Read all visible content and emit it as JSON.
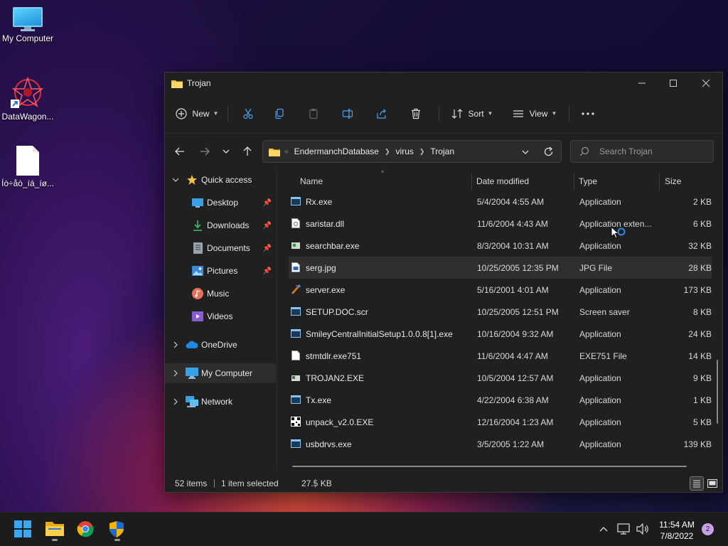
{
  "desktop": {
    "icons": [
      {
        "label": "My Computer"
      },
      {
        "label": "DataWagon..."
      },
      {
        "label": "Íò÷åò_íá_íø..."
      }
    ]
  },
  "window": {
    "title": "Trojan",
    "toolbar": {
      "new_label": "New",
      "sort_label": "Sort",
      "view_label": "View"
    },
    "address": {
      "crumbs": [
        "EndermanchDatabase",
        "virus",
        "Trojan"
      ]
    },
    "search": {
      "placeholder": "Search Trojan"
    },
    "nav": {
      "quick_access": "Quick access",
      "items": [
        {
          "label": "Desktop",
          "icon": "desktop-icon",
          "pinned": true
        },
        {
          "label": "Downloads",
          "icon": "download-icon",
          "pinned": true
        },
        {
          "label": "Documents",
          "icon": "document-icon",
          "pinned": true
        },
        {
          "label": "Pictures",
          "icon": "picture-icon",
          "pinned": true
        },
        {
          "label": "Music",
          "icon": "music-icon",
          "pinned": false
        },
        {
          "label": "Videos",
          "icon": "video-icon",
          "pinned": false
        }
      ],
      "onedrive": "OneDrive",
      "my_computer": "My Computer",
      "network": "Network"
    },
    "columns": {
      "name": "Name",
      "date": "Date modified",
      "type": "Type",
      "size": "Size"
    },
    "files": [
      {
        "name": "Rx.exe",
        "date": "5/4/2004 4:55 AM",
        "type": "Application",
        "size": "2 KB"
      },
      {
        "name": "saristar.dll",
        "date": "11/6/2004 4:43 AM",
        "type": "Application exten...",
        "size": "6 KB"
      },
      {
        "name": "searchbar.exe",
        "date": "8/3/2004 10:31 AM",
        "type": "Application",
        "size": "32 KB"
      },
      {
        "name": "serg.jpg",
        "date": "10/25/2005 12:35 PM",
        "type": "JPG File",
        "size": "28 KB"
      },
      {
        "name": "server.exe",
        "date": "5/16/2001 4:01 AM",
        "type": "Application",
        "size": "173 KB"
      },
      {
        "name": "SETUP.DOC.scr",
        "date": "10/25/2005 12:51 PM",
        "type": "Screen saver",
        "size": "8 KB"
      },
      {
        "name": "SmileyCentralInitialSetup1.0.0.8[1].exe",
        "date": "10/16/2004 9:32 AM",
        "type": "Application",
        "size": "24 KB"
      },
      {
        "name": "stmtdlr.exe751",
        "date": "11/6/2004 4:47 AM",
        "type": "EXE751 File",
        "size": "14 KB"
      },
      {
        "name": "TROJAN2.EXE",
        "date": "10/5/2004 12:57 AM",
        "type": "Application",
        "size": "9 KB"
      },
      {
        "name": "Tx.exe",
        "date": "4/22/2004 6:38 AM",
        "type": "Application",
        "size": "1 KB"
      },
      {
        "name": "unpack_v2.0.EXE",
        "date": "12/16/2004 1:23 AM",
        "type": "Application",
        "size": "5 KB"
      },
      {
        "name": "usbdrvs.exe",
        "date": "3/5/2005 1:22 AM",
        "type": "Application",
        "size": "139 KB"
      }
    ],
    "status": {
      "items": "52 items",
      "selected": "1 item selected",
      "size": "27.5 KB"
    }
  },
  "taskbar": {
    "time": "11:54 AM",
    "date": "7/8/2022",
    "notifications": "2"
  },
  "colors": {
    "accent": "#0078d4",
    "folder": "#f5c242"
  }
}
